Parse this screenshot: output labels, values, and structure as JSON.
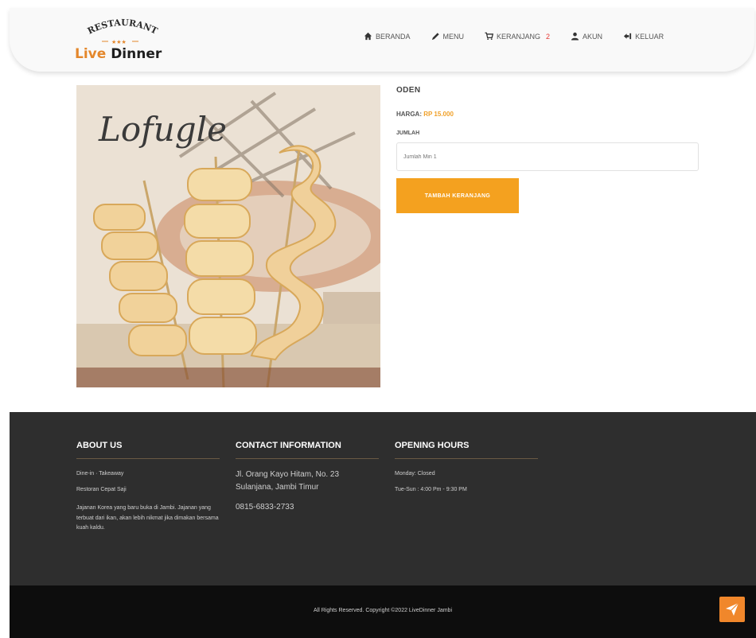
{
  "brand": {
    "arc_text": "RESTAURANT",
    "name_accent": "Live",
    "name_rest": " Dinner"
  },
  "nav": [
    {
      "label": "BERANDA",
      "icon": "home-icon"
    },
    {
      "label": "MENU",
      "icon": "pencil-icon"
    },
    {
      "label": "KERANJANG",
      "icon": "cart-icon",
      "badge": "2"
    },
    {
      "label": "AKUN",
      "icon": "user-icon"
    },
    {
      "label": "KELUAR",
      "icon": "logout-icon"
    }
  ],
  "product": {
    "name": "ODEN",
    "price_label": "HARGA:",
    "price_value": "RP 15.000",
    "qty_label": "JUMLAH",
    "qty_placeholder": "Jumlah Min 1",
    "add_button": "TAMBAH KERANJANG",
    "image_caption": "Lofugle"
  },
  "footer": {
    "about": {
      "title": "ABOUT US",
      "line1": "Dine-in · Takeaway",
      "line2": "Restoran Cepat Saji",
      "desc": "Jajanan Korea yang baru buka di Jambi. Jajanan yang terbuat dari ikan, akan lebih nikmat jika dimakan bersama kuah kaldu."
    },
    "contact": {
      "title": "CONTACT INFORMATION",
      "address": "Jl. Orang Kayo Hitam, No. 23 Sulanjana, Jambi Timur",
      "phone": "0815-6833-2733"
    },
    "hours": {
      "title": "OPENING HOURS",
      "line1": "Monday: Closed",
      "line2": "Tue-Sun : 4:00 Pm - 9:30 PM"
    },
    "copyright": "All Rights Reserved. Copyright ©2022 LiveDinner Jambi"
  },
  "colors": {
    "accent": "#f4a11f",
    "footer_dark": "#2e2e2e",
    "footer_black": "#0d0d0d"
  }
}
